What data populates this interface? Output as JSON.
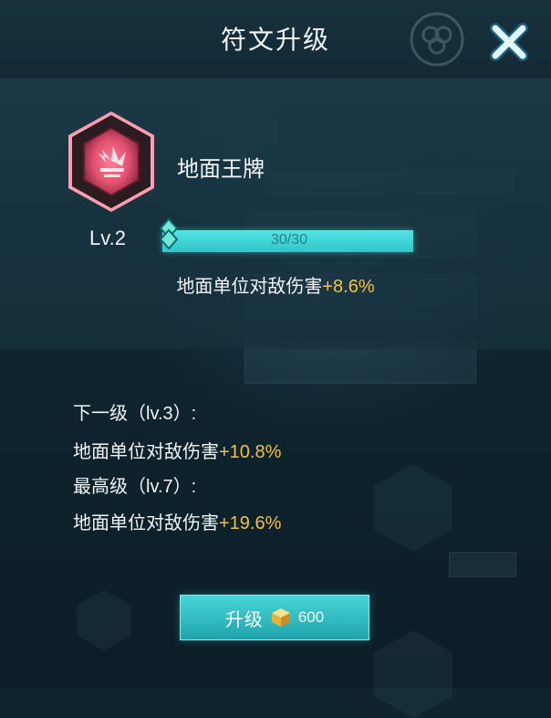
{
  "dialog": {
    "title": "符文升级"
  },
  "rune": {
    "name": "地面王牌",
    "level": "Lv.2",
    "xp_text": "30/30",
    "xp_fraction": 1.0,
    "effect_label": "地面单位对敌伤害",
    "effect_value": "+8.6%"
  },
  "next_level": {
    "heading": "下一级（lv.3）:",
    "effect_label": "地面单位对敌伤害",
    "effect_value": "+10.8%"
  },
  "max_level": {
    "heading": "最高级（lv.7）:",
    "effect_label": "地面单位对敌伤害",
    "effect_value": "+19.6%"
  },
  "upgrade": {
    "label": "升级",
    "cost": "600",
    "currency_icon": "gold-cube-icon"
  },
  "colors": {
    "accent": "#3fcfd2",
    "bonus": "#f0c04a",
    "gem": "#e85a78"
  }
}
